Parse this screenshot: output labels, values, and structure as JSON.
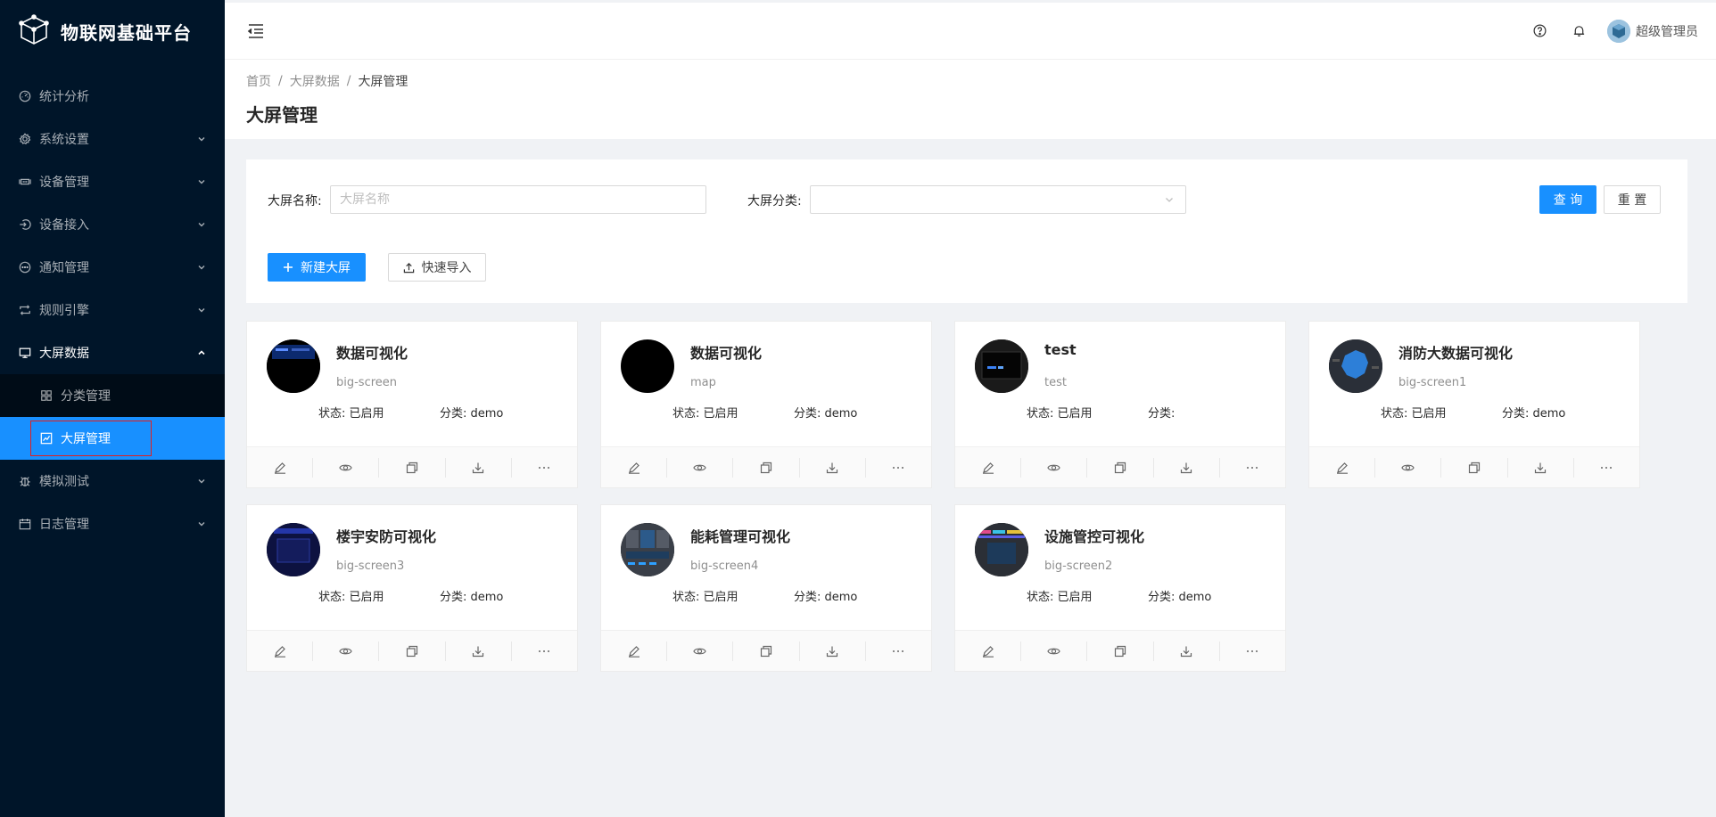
{
  "brand": {
    "title": "物联网基础平台"
  },
  "sidebar": {
    "items": [
      {
        "label": "统计分析",
        "icon": "dashboard-icon",
        "has_children": false
      },
      {
        "label": "系统设置",
        "icon": "gear-icon",
        "has_children": true
      },
      {
        "label": "设备管理",
        "icon": "device-icon",
        "has_children": true
      },
      {
        "label": "设备接入",
        "icon": "login-icon",
        "has_children": true
      },
      {
        "label": "通知管理",
        "icon": "message-icon",
        "has_children": true
      },
      {
        "label": "规则引擎",
        "icon": "retweet-icon",
        "has_children": true
      },
      {
        "label": "大屏数据",
        "icon": "desktop-icon",
        "has_children": true,
        "open": true,
        "children": [
          {
            "label": "分类管理",
            "icon": "appstore-icon"
          },
          {
            "label": "大屏管理",
            "icon": "chart-icon",
            "active": true
          }
        ]
      },
      {
        "label": "模拟测试",
        "icon": "bug-icon",
        "has_children": true
      },
      {
        "label": "日志管理",
        "icon": "calendar-icon",
        "has_children": true
      }
    ]
  },
  "header": {
    "user": "超级管理员"
  },
  "breadcrumb": [
    "首页",
    "大屏数据",
    "大屏管理"
  ],
  "page_title": "大屏管理",
  "filter": {
    "name_label": "大屏名称:",
    "name_placeholder": "大屏名称",
    "category_label": "大屏分类:",
    "query_button": "查 询",
    "reset_button": "重 置",
    "new_button": "新建大屏",
    "import_button": "快速导入"
  },
  "labels": {
    "status_prefix": "状态: ",
    "category_prefix": "分类: "
  },
  "cards": [
    {
      "title": "数据可视化",
      "code": "big-screen",
      "status": "已启用",
      "category": "demo",
      "thumb": "dark-blue"
    },
    {
      "title": "数据可视化",
      "code": "map",
      "status": "已启用",
      "category": "demo",
      "thumb": "black"
    },
    {
      "title": "test",
      "code": "test",
      "status": "已启用",
      "category": "",
      "thumb": "dark-screen"
    },
    {
      "title": "消防大数据可视化",
      "code": "big-screen1",
      "status": "已启用",
      "category": "demo",
      "thumb": "map-blue"
    },
    {
      "title": "楼宇安防可视化",
      "code": "big-screen3",
      "status": "已启用",
      "category": "demo",
      "thumb": "navy"
    },
    {
      "title": "能耗管理可视化",
      "code": "big-screen4",
      "status": "已启用",
      "category": "demo",
      "thumb": "dashboard-grey"
    },
    {
      "title": "设施管控可视化",
      "code": "big-screen2",
      "status": "已启用",
      "category": "demo",
      "thumb": "colorful"
    }
  ],
  "card_actions": [
    "edit-icon",
    "eye-icon",
    "copy-icon",
    "download-icon",
    "more-icon"
  ],
  "colors": {
    "primary": "#1890ff",
    "sidebar_bg": "#001529",
    "submenu_bg": "#000c17",
    "highlight_border": "#e02020"
  }
}
